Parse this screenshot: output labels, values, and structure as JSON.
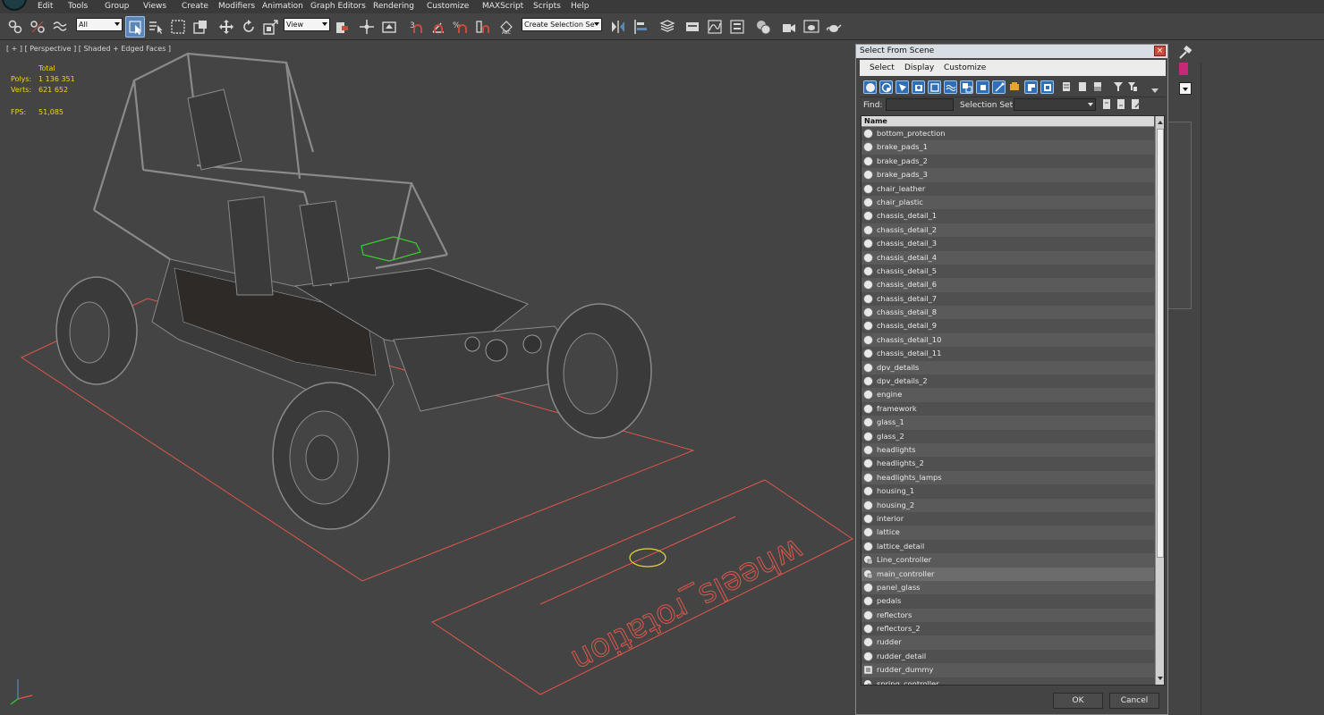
{
  "menu": {
    "items": [
      "Edit",
      "Tools",
      "Group",
      "Views",
      "Create",
      "Modifiers",
      "Animation",
      "Graph Editors",
      "Rendering",
      "Customize",
      "MAXScript",
      "Scripts",
      "Help"
    ]
  },
  "toolbar": {
    "selection_filter": "All",
    "reference_coord": "View",
    "named_selection_set": "Create Selection Se"
  },
  "viewport": {
    "label": "[ + ] [ Perspective ] [ Shaded + Edged Faces ]",
    "stats": {
      "total_label": "Total",
      "polys_label": "Polys:",
      "polys_value": "1 136 351",
      "verts_label": "Verts:",
      "verts_value": "621 652",
      "fps_label": "FPS:",
      "fps_value": "51,085"
    },
    "helper_text": "wheels_rotation"
  },
  "dialog": {
    "title": "Select From Scene",
    "close_glyph": "×",
    "menu": [
      "Select",
      "Display",
      "Customize"
    ],
    "find_label": "Find:",
    "find_value": "",
    "selection_set_label": "Selection Set:",
    "column_header": "Name",
    "items": [
      {
        "name": "bottom_protection",
        "kind": "geometry"
      },
      {
        "name": "brake_pads_1",
        "kind": "geometry"
      },
      {
        "name": "brake_pads_2",
        "kind": "geometry"
      },
      {
        "name": "brake_pads_3",
        "kind": "geometry"
      },
      {
        "name": "chair_leather",
        "kind": "geometry"
      },
      {
        "name": "chair_plastic",
        "kind": "geometry"
      },
      {
        "name": "chassis_detail_1",
        "kind": "geometry"
      },
      {
        "name": "chassis_detail_2",
        "kind": "geometry"
      },
      {
        "name": "chassis_detail_3",
        "kind": "geometry"
      },
      {
        "name": "chassis_detail_4",
        "kind": "geometry"
      },
      {
        "name": "chassis_detail_5",
        "kind": "geometry"
      },
      {
        "name": "chassis_detail_6",
        "kind": "geometry"
      },
      {
        "name": "chassis_detail_7",
        "kind": "geometry"
      },
      {
        "name": "chassis_detail_8",
        "kind": "geometry"
      },
      {
        "name": "chassis_detail_9",
        "kind": "geometry"
      },
      {
        "name": "chassis_detail_10",
        "kind": "geometry"
      },
      {
        "name": "chassis_detail_11",
        "kind": "geometry"
      },
      {
        "name": "dpv_details",
        "kind": "geometry"
      },
      {
        "name": "dpv_details_2",
        "kind": "geometry"
      },
      {
        "name": "engine",
        "kind": "geometry"
      },
      {
        "name": "framework",
        "kind": "geometry"
      },
      {
        "name": "glass_1",
        "kind": "geometry"
      },
      {
        "name": "glass_2",
        "kind": "geometry"
      },
      {
        "name": "headlights",
        "kind": "geometry"
      },
      {
        "name": "headlights_2",
        "kind": "geometry"
      },
      {
        "name": "headlights_lamps",
        "kind": "geometry"
      },
      {
        "name": "housing_1",
        "kind": "geometry"
      },
      {
        "name": "housing_2",
        "kind": "geometry"
      },
      {
        "name": "interior",
        "kind": "geometry"
      },
      {
        "name": "lattice",
        "kind": "geometry"
      },
      {
        "name": "lattice_detail",
        "kind": "geometry"
      },
      {
        "name": "Line_controller",
        "kind": "shape"
      },
      {
        "name": "main_controller",
        "kind": "shape",
        "selected": true
      },
      {
        "name": "panel_glass",
        "kind": "geometry"
      },
      {
        "name": "pedals",
        "kind": "geometry"
      },
      {
        "name": "reflectors",
        "kind": "geometry"
      },
      {
        "name": "reflectors_2",
        "kind": "geometry"
      },
      {
        "name": "rudder",
        "kind": "geometry"
      },
      {
        "name": "rudder_detail",
        "kind": "geometry"
      },
      {
        "name": "rudder_dummy",
        "kind": "helper"
      },
      {
        "name": "spring_controller",
        "kind": "shape"
      }
    ],
    "ok_label": "OK",
    "cancel_label": "Cancel"
  },
  "colors": {
    "viewport_bg": "#444444",
    "wire": "#8a8a8a",
    "controller_red": "#e0574a",
    "stats_yellow": "#f2d21c",
    "selection_blue": "#5b87b8",
    "wire_green": "#35d12b"
  }
}
